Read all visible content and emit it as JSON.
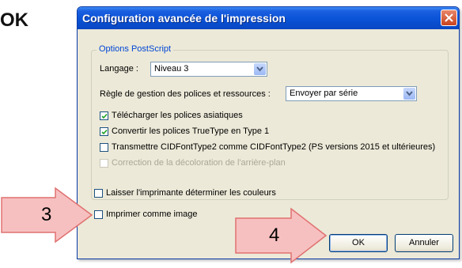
{
  "heading": "OK",
  "dialog": {
    "title": "Configuration avancée de l'impression"
  },
  "postscript_group": {
    "legend": "Options PostScript",
    "language_label": "Langage :",
    "language_value": "Niveau 3",
    "font_rule_label": "Règle de gestion des polices et ressources :",
    "font_rule_value": "Envoyer par série",
    "options": [
      {
        "label": "Télécharger les polices asiatiques",
        "checked": true,
        "enabled": true
      },
      {
        "label": "Convertir les polices TrueType en Type 1",
        "checked": true,
        "enabled": true
      },
      {
        "label": "Transmettre CIDFontType2 comme CIDFontType2 (PS versions 2015 et ultérieures)",
        "checked": false,
        "enabled": true
      },
      {
        "label": "Correction de la décoloration de l'arrière-plan",
        "checked": false,
        "enabled": false
      }
    ]
  },
  "printer_colors": {
    "label": "Laisser l'imprimante déterminer les couleurs",
    "checked": false
  },
  "print_as_image": {
    "label": "Imprimer comme image",
    "checked": false
  },
  "buttons": {
    "ok": "OK",
    "cancel": "Annuler"
  },
  "callouts": {
    "step3": "3",
    "step4": "4"
  },
  "colors": {
    "titlebar": "#0a52d6",
    "callout_fill": "#f7c0c0",
    "callout_stroke": "#e07070"
  }
}
